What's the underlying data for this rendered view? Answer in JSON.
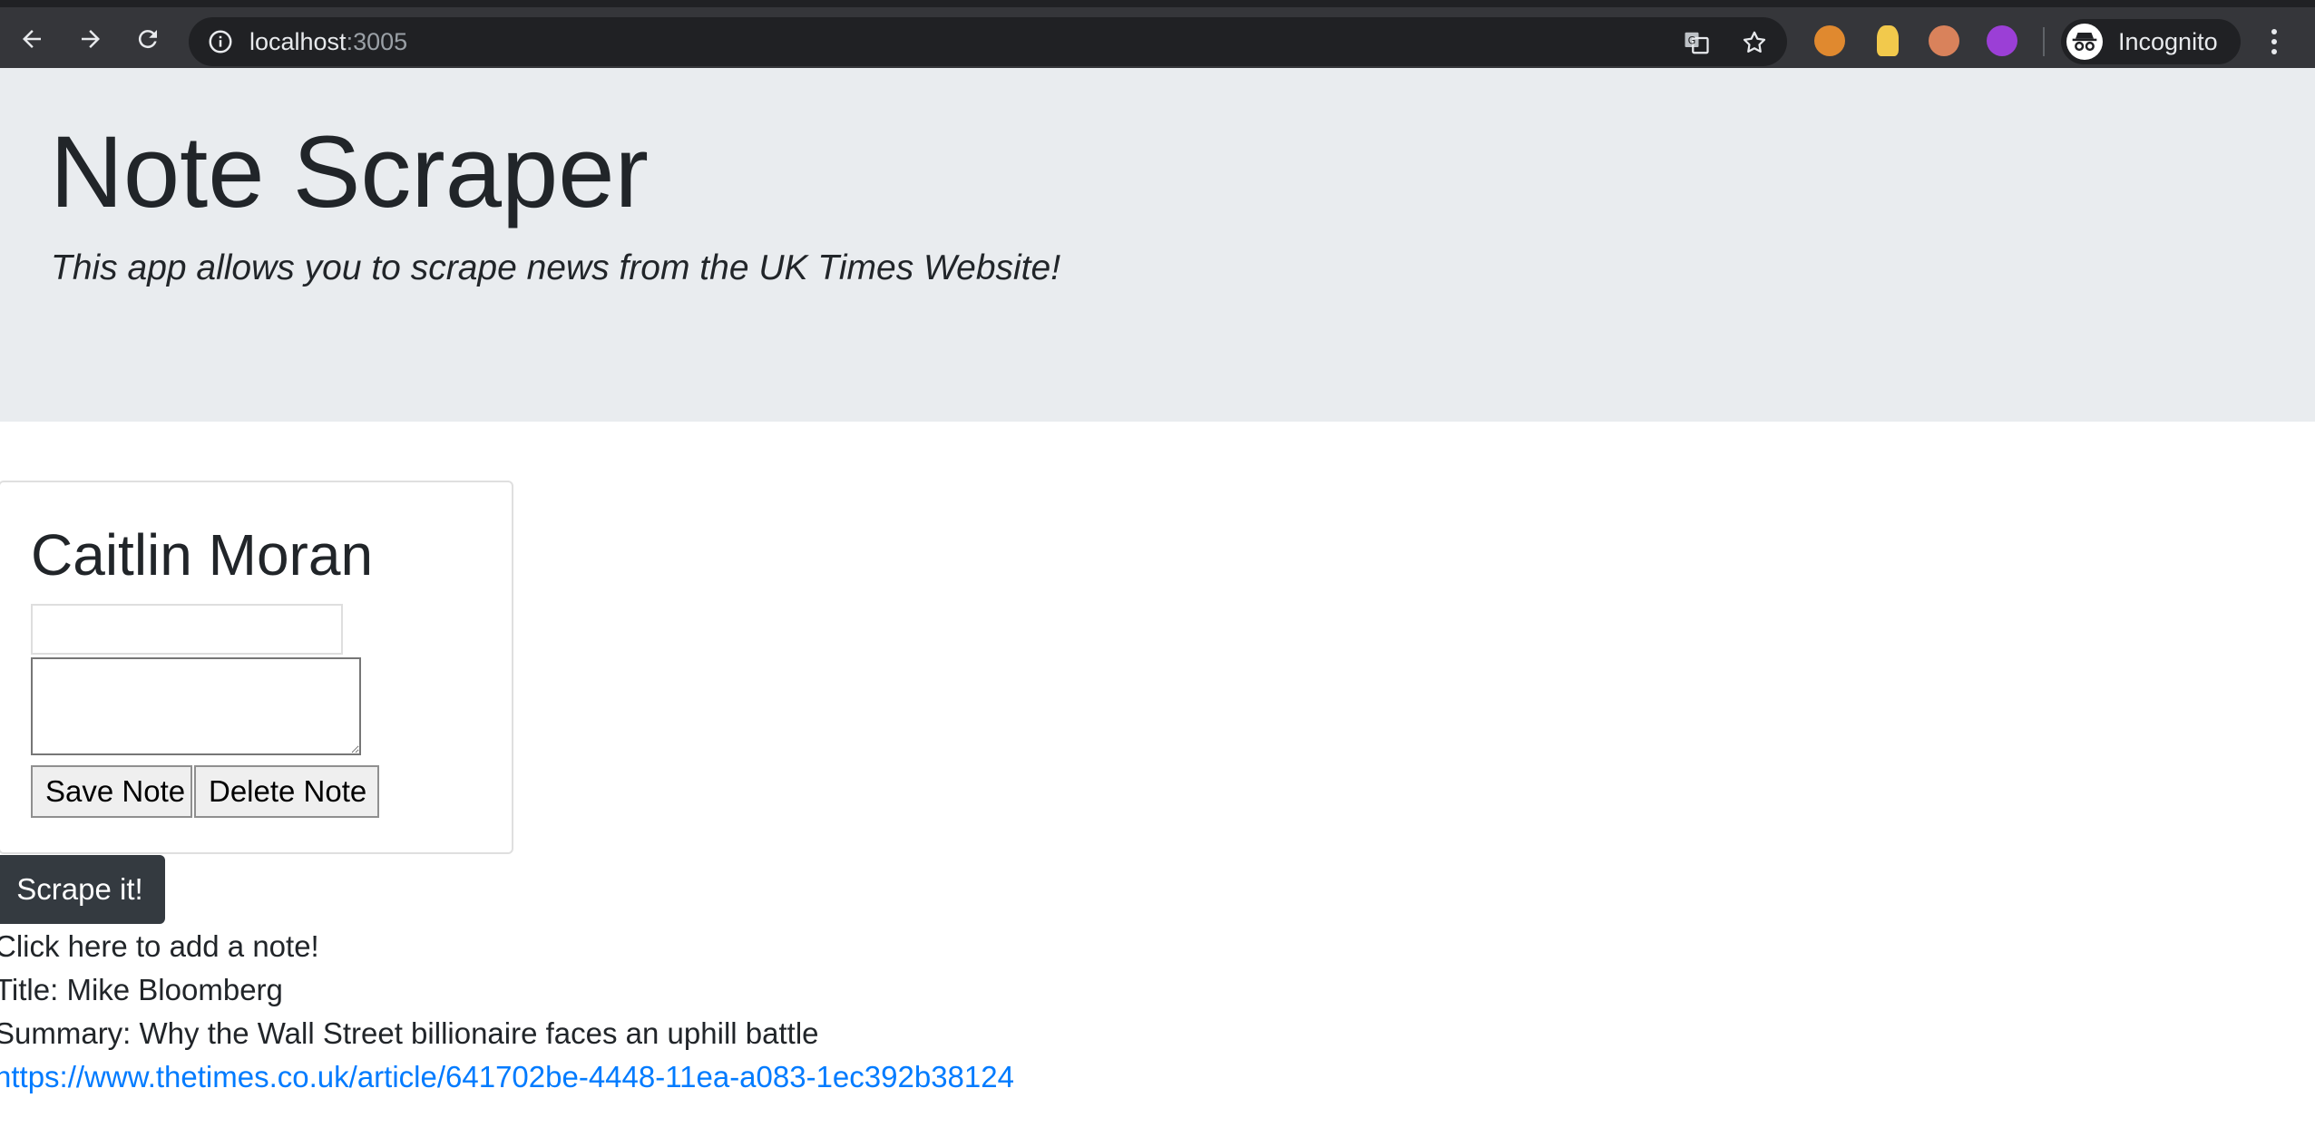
{
  "browser": {
    "url_host": "localhost",
    "url_port": ":3005",
    "profile_label": "Incognito",
    "icons": [
      "back-icon",
      "forward-icon",
      "reload-icon",
      "info-icon",
      "translate-icon",
      "star-icon",
      "cookie-extension-icon",
      "lightbulb-extension-icon",
      "head-extension-icon",
      "purple-extension-icon",
      "incognito-icon",
      "more-menu-icon"
    ]
  },
  "jumbotron": {
    "title": "Note Scraper",
    "lead": "This app allows you to scrape news from the UK Times Website!"
  },
  "note_card": {
    "title": "Caitlin Moran",
    "title_input_value": "",
    "body_input_value": "",
    "save_label": "Save Note",
    "delete_label": "Delete Note"
  },
  "scrape_button_label": "Scrape it!",
  "article": {
    "add_note_text": "Click here to add a note!",
    "title_line": "Title: Mike Bloomberg",
    "summary_line": "Summary: Why the Wall Street billionaire faces an uphill battle",
    "link": "https://www.thetimes.co.uk/article/641702be-4448-11ea-a083-1ec392b38124"
  },
  "colors": {
    "chrome_bg": "#35363a",
    "omnibox_bg": "#202124",
    "jumbotron_bg": "#e9ecef",
    "scrape_button_bg": "#343a40",
    "link": "#007bff"
  }
}
